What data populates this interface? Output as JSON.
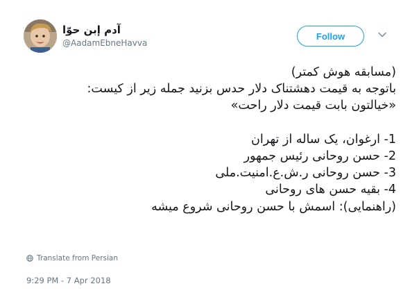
{
  "user": {
    "display_name": "آدم إبن حوّا",
    "handle": "@AadamEbneHavva",
    "avatar_icon": "user-avatar-photo"
  },
  "follow_button": {
    "label": "Follow",
    "accent_color": "#1da1f2"
  },
  "menu_icon": "chevron-down-icon",
  "tweet": {
    "lines": [
      "(مسابقه هوش کمتر)",
      "باتوجه به قیمت دهشتناک دلار حدس بزنید جمله زیر از کیست:",
      "«خیالتون بابت قیمت دلار راحت»",
      "",
      "1- ارغوان، یک ساله از تهران",
      "2- حسن روحانی رئیس جمهور",
      "3- حسن روحانی ر.ش.ع.امنیت.ملی",
      "4- بقیه حسن های روحانی",
      "(راهنمایی): اسمش با حسن روحانی شروع میشه"
    ]
  },
  "translate": {
    "label": "Translate from Persian",
    "icon": "globe-icon"
  },
  "timestamp": "9:29 PM - 7 Apr 2018"
}
